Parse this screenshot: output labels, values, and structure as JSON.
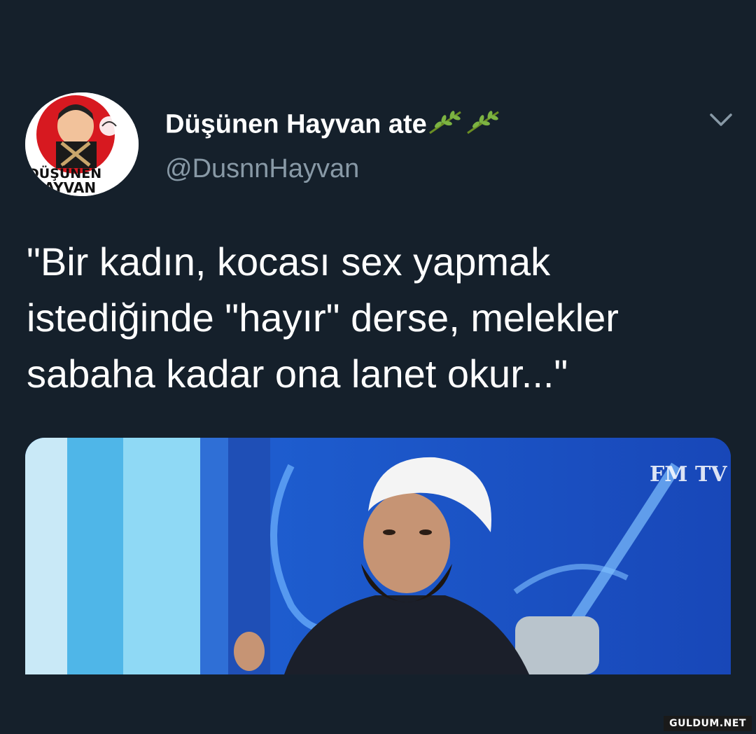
{
  "tweet": {
    "author_name": "Düşünen Hayvan ate",
    "author_handle": "@DusnnHayvan",
    "text": "\"Bir kadın, kocası sex yapmak istediğinde \"hayır\" derse, melekler sabaha kadar ona lanet okur...\"",
    "avatar": {
      "label_line1": "DÜŞÜNEN",
      "label_line2": "HAYVAN"
    },
    "media": {
      "channel_logo": "FM TV"
    }
  },
  "watermark": "GULDUM.NET",
  "icons": {
    "name_emoji": "herb-icon",
    "menu": "chevron-down-icon"
  },
  "colors": {
    "background": "#15202b",
    "primary_text": "#ffffff",
    "secondary_text": "#8899a6",
    "media_blue": "#1b56c9"
  }
}
